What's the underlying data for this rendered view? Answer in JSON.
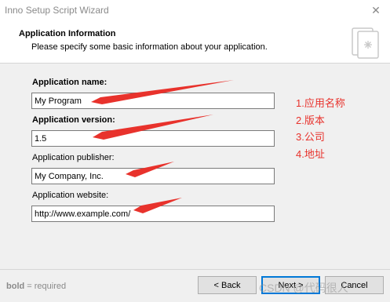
{
  "window": {
    "title": "Inno Setup Script Wizard",
    "close_glyph": "✕"
  },
  "header": {
    "title": "Application Information",
    "subtitle": "Please specify some basic information about your application.",
    "icon": "setup-wizard-icon"
  },
  "form": {
    "app_name": {
      "label": "Application name:",
      "value": "My Program",
      "required": true
    },
    "app_version": {
      "label": "Application version:",
      "value": "1.5",
      "required": true
    },
    "app_publisher": {
      "label": "Application publisher:",
      "value": "My Company, Inc.",
      "required": false
    },
    "app_website": {
      "label": "Application website:",
      "value": "http://www.example.com/",
      "required": false
    }
  },
  "annotations": {
    "color": "#e8322c",
    "items": [
      "1.应用名称",
      "2.版本",
      "3.公司",
      "4.地址"
    ]
  },
  "footer": {
    "legend_bold": "bold",
    "legend_rest": " = required",
    "back_label": "< Back",
    "next_label": "Next >",
    "cancel_label": "Cancel"
  },
  "watermark": "CSDN @代码很人"
}
